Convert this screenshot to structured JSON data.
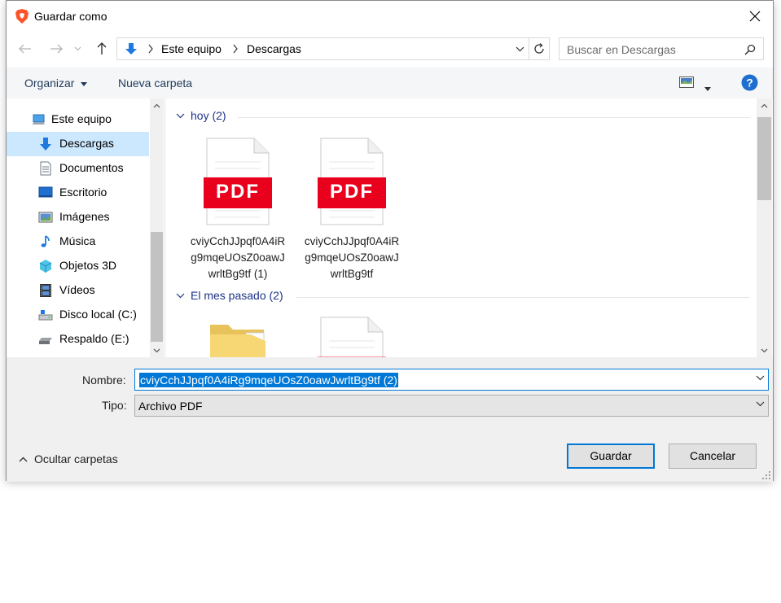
{
  "window": {
    "title": "Guardar como",
    "accent": "#0078d7"
  },
  "address_bar": {
    "crumbs": [
      "Este equipo",
      "Descargas"
    ]
  },
  "search": {
    "placeholder": "Buscar en Descargas"
  },
  "toolbar": {
    "organize_label": "Organizar",
    "new_folder_label": "Nueva carpeta"
  },
  "sidebar": {
    "items": [
      {
        "label": "Este equipo",
        "icon": "computer-icon"
      },
      {
        "label": "Descargas",
        "icon": "download-icon",
        "selected": true
      },
      {
        "label": "Documentos",
        "icon": "documents-icon"
      },
      {
        "label": "Escritorio",
        "icon": "desktop-icon"
      },
      {
        "label": "Imágenes",
        "icon": "pictures-icon"
      },
      {
        "label": "Música",
        "icon": "music-icon"
      },
      {
        "label": "Objetos 3D",
        "icon": "3d-objects-icon"
      },
      {
        "label": "Vídeos",
        "icon": "videos-icon"
      },
      {
        "label": "Disco local (C:)",
        "icon": "local-disk-icon"
      },
      {
        "label": "Respaldo (E:)",
        "icon": "removable-drive-icon"
      }
    ]
  },
  "groups": [
    {
      "label": "hoy (2)",
      "files": [
        {
          "name": "cviyCchJJpqf0A4iRg9mqeUOsZ0oawJwrltBg9tf (1)",
          "icon": "pdf-file-icon",
          "badge": "PDF"
        },
        {
          "name": "cviyCchJJpqf0A4iRg9mqeUOsZ0oawJwrltBg9tf",
          "icon": "pdf-file-icon",
          "badge": "PDF"
        }
      ]
    },
    {
      "label": "El mes pasado (2)",
      "files": [
        {
          "name": "",
          "icon": "folder-icon"
        },
        {
          "name": "",
          "icon": "file-icon"
        }
      ]
    }
  ],
  "form": {
    "name_label": "Nombre:",
    "name_value": "cviyCchJJpqf0A4iRg9mqeUOsZ0oawJwrltBg9tf (2)",
    "type_label": "Tipo:",
    "type_value": "Archivo PDF",
    "hide_folders_label": "Ocultar carpetas",
    "save_label": "Guardar",
    "cancel_label": "Cancelar"
  },
  "colors": {
    "pdf_red": "#e8001c",
    "selection": "#cce8ff",
    "group_header": "#1e3287"
  }
}
